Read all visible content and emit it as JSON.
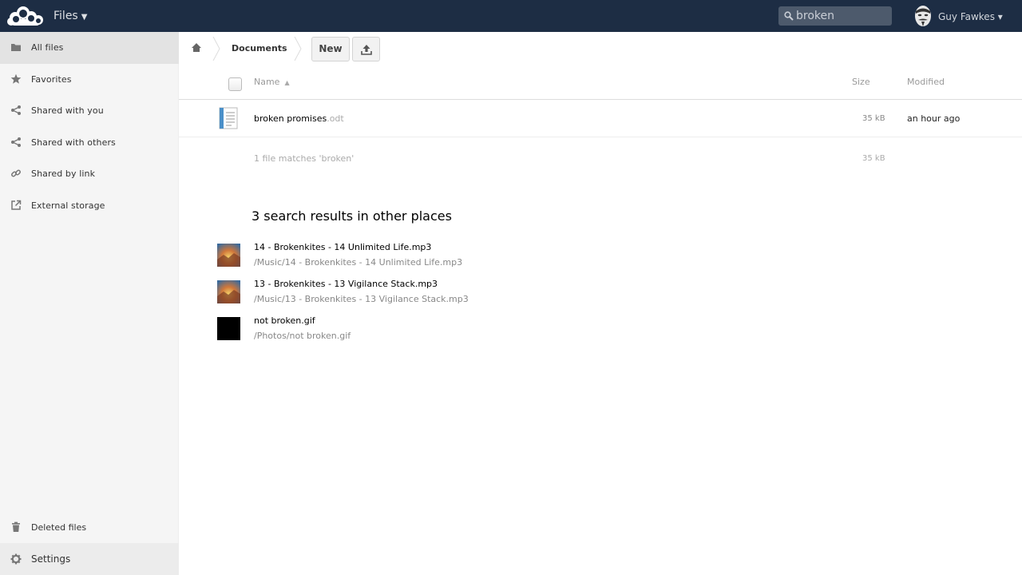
{
  "header": {
    "app_name": "Files",
    "search_value": "broken",
    "user_name": "Guy Fawkes ▾"
  },
  "sidebar": {
    "items": [
      {
        "label": "All files",
        "icon": "folder-icon"
      },
      {
        "label": "Favorites",
        "icon": "star-icon"
      },
      {
        "label": "Shared with you",
        "icon": "share-icon"
      },
      {
        "label": "Shared with others",
        "icon": "share-icon"
      },
      {
        "label": "Shared by link",
        "icon": "link-icon"
      },
      {
        "label": "External storage",
        "icon": "external-icon"
      }
    ],
    "deleted_label": "Deleted files",
    "settings_label": "Settings"
  },
  "controls": {
    "breadcrumb": "Documents",
    "new_label": "New"
  },
  "table": {
    "col_name": "Name",
    "sort_indicator": "▲",
    "col_size": "Size",
    "col_modified": "Modified",
    "files": [
      {
        "name": "broken promises",
        "ext": ".odt",
        "size": "35 kB",
        "modified": "an hour ago"
      }
    ],
    "summary": "1 file matches 'broken'",
    "summary_size": "35 kB"
  },
  "other_results": {
    "title": "3 search results in other places",
    "items": [
      {
        "name": "14 - Brokenkites - 14 Unlimited Life.mp3",
        "path": "/Music/14 - Brokenkites - 14 Unlimited Life.mp3",
        "thumb": "album-art"
      },
      {
        "name": "13 - Brokenkites - 13 Vigilance Stack.mp3",
        "path": "/Music/13 - Brokenkites - 13 Vigilance Stack.mp3",
        "thumb": "album-art"
      },
      {
        "name": "not broken.gif",
        "path": "/Photos/not broken.gif",
        "thumb": "black"
      }
    ]
  },
  "colors": {
    "header_bg": "#1d2d44",
    "sidebar_bg": "#f5f5f5"
  }
}
